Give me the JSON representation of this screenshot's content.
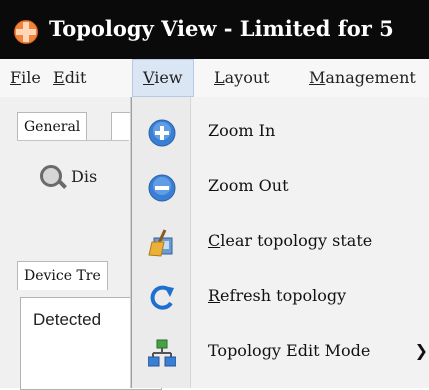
{
  "window": {
    "title": "Topology View - Limited for 5"
  },
  "menubar": {
    "items": [
      {
        "label": "File",
        "underline": "F",
        "active": false
      },
      {
        "label": "Edit",
        "underline": "E",
        "active": false
      },
      {
        "label": "View",
        "underline": "V",
        "active": true
      },
      {
        "label": "Layout",
        "underline": "L",
        "active": false
      },
      {
        "label": "Management",
        "underline": "M",
        "active": false
      }
    ]
  },
  "tabs": {
    "general": "General",
    "device_tree": "Device Tre"
  },
  "discover": {
    "label": "Dis"
  },
  "tree": {
    "detected": "Detected"
  },
  "view_menu": {
    "items": [
      {
        "label": "Zoom In",
        "icon": "zoom-in-icon",
        "underline": ""
      },
      {
        "label": "Zoom Out",
        "icon": "zoom-out-icon",
        "underline": ""
      },
      {
        "label": "Clear topology state",
        "icon": "broom-icon",
        "underline": "C"
      },
      {
        "label": "Refresh topology",
        "icon": "refresh-icon",
        "underline": "R"
      },
      {
        "label": "Topology Edit Mode",
        "icon": "topology-edit-icon",
        "underline": "",
        "submenu": true
      }
    ]
  },
  "colors": {
    "titlebar": "#0a0a0a",
    "menu_highlight": "#dbe6f5",
    "icon_blue": "#3a7fd6",
    "accent_orange": "#f2833a"
  }
}
